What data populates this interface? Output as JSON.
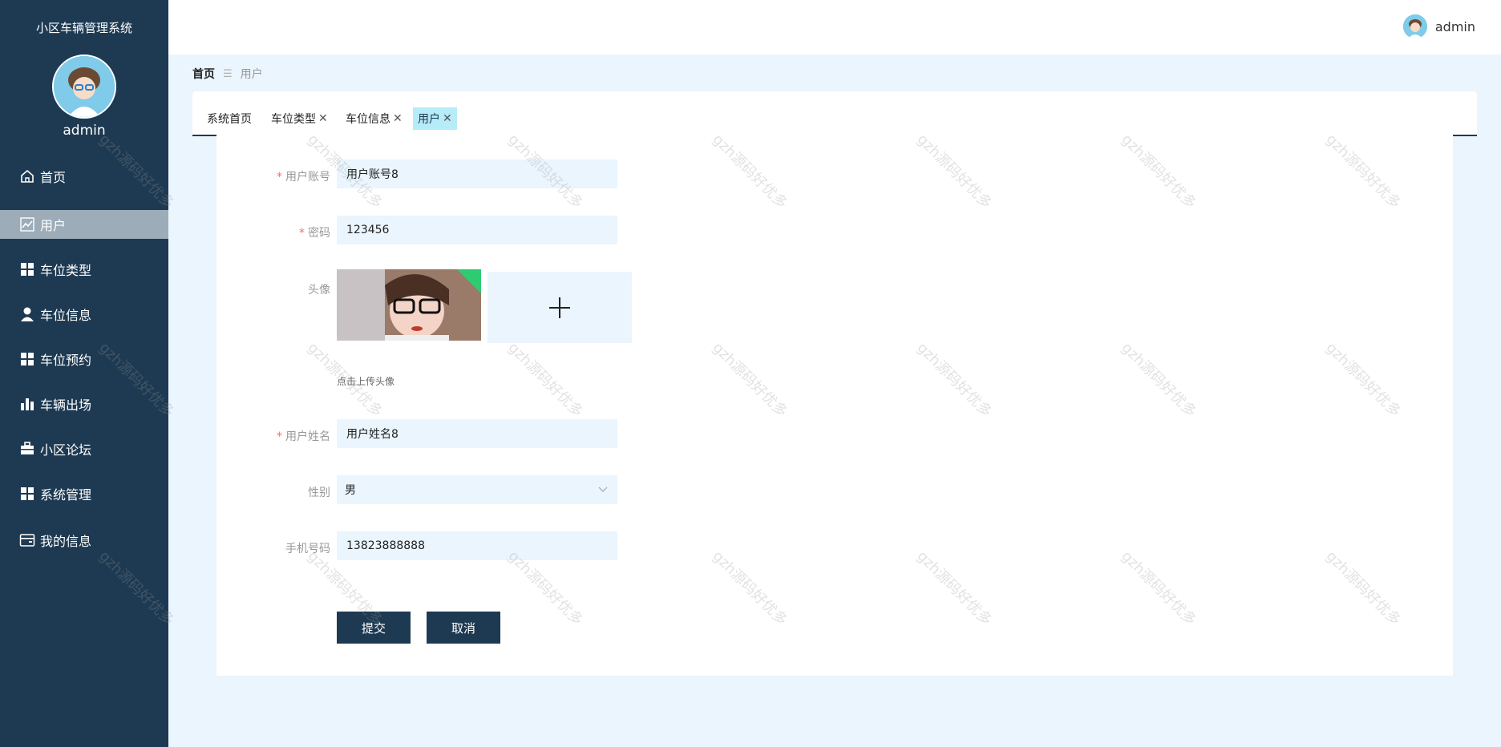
{
  "app": {
    "title": "小区车辆管理系统"
  },
  "sidebar": {
    "username": "admin",
    "items": [
      {
        "label": "首页",
        "icon": "home-icon"
      },
      {
        "label": "用户",
        "icon": "line-chart-icon"
      },
      {
        "label": "车位类型",
        "icon": "grid-icon"
      },
      {
        "label": "车位信息",
        "icon": "person-icon"
      },
      {
        "label": "车位预约",
        "icon": "grid-icon"
      },
      {
        "label": "车辆出场",
        "icon": "bar-chart-icon"
      },
      {
        "label": "小区论坛",
        "icon": "briefcase-icon"
      },
      {
        "label": "系统管理",
        "icon": "grid-icon"
      },
      {
        "label": "我的信息",
        "icon": "card-icon"
      }
    ]
  },
  "topbar": {
    "username": "admin"
  },
  "breadcrumb": {
    "home": "首页",
    "separator": "☰",
    "current": "用户"
  },
  "tabs": [
    {
      "label": "系统首页",
      "closable": false
    },
    {
      "label": "车位类型",
      "closable": true
    },
    {
      "label": "车位信息",
      "closable": true
    },
    {
      "label": "用户",
      "closable": true
    }
  ],
  "tab_close_glyph": "✕",
  "form": {
    "account": {
      "label": "用户账号",
      "value": "用户账号8",
      "required": "*"
    },
    "password": {
      "label": "密码",
      "value": "123456",
      "required": "*"
    },
    "avatar": {
      "label": "头像",
      "tip": "点击上传头像"
    },
    "name": {
      "label": "用户姓名",
      "value": "用户姓名8",
      "required": "*"
    },
    "gender": {
      "label": "性别",
      "value": "男"
    },
    "phone": {
      "label": "手机号码",
      "value": "13823888888"
    },
    "submit": "提交",
    "cancel": "取消"
  },
  "watermark": "gzh源码好优多",
  "colors": {
    "sidebar": "#1e3a52",
    "active_menu": "#9cacb8",
    "active_tab": "#b5ecf7",
    "input_bg": "#eaf5fe",
    "required": "#f56c6c"
  }
}
